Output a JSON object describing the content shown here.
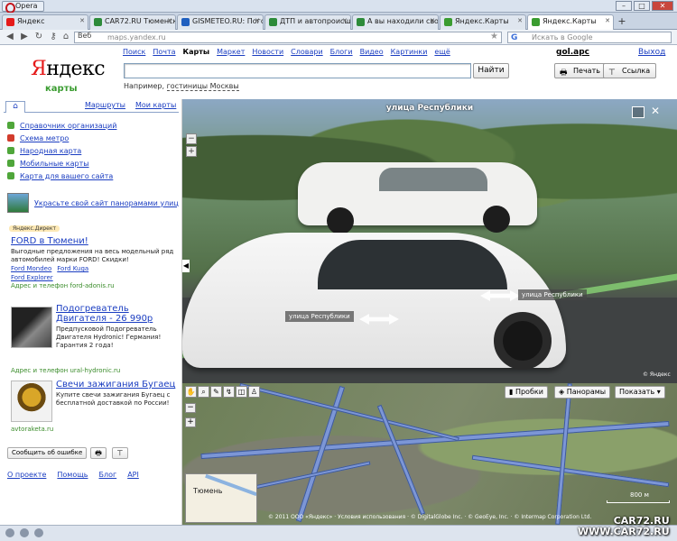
{
  "browser": {
    "app_button": "Opera",
    "tabs": [
      {
        "label": "Яндекс",
        "color": "#e51a1a"
      },
      {
        "label": "CAR72.RU Тюменски...",
        "color": "#2d8b3a"
      },
      {
        "label": "GISMETEO.RU: Погод...",
        "color": "#1f5fbf"
      },
      {
        "label": "ДТП и автопроисше...",
        "color": "#2d8b3a"
      },
      {
        "label": "А вы находили свой ...",
        "color": "#2d8b3a"
      },
      {
        "label": "Яндекс.Карты",
        "color": "#3a9c30"
      },
      {
        "label": "Яндекс.Карты",
        "color": "#3a9c30",
        "active": true
      }
    ],
    "web_label": "Веб",
    "url": "maps.yandex.ru",
    "search_placeholder": "Искать в Google"
  },
  "header": {
    "logo_first": "Я",
    "logo_rest": "ндекс",
    "logo_sub": "карты",
    "nav": [
      "Поиск",
      "Почта",
      "Карты",
      "Маркет",
      "Новости",
      "Словари",
      "Блоги",
      "Видео",
      "Картинки",
      "ещё"
    ],
    "current_nav": "Карты",
    "user": "gol.apc",
    "exit": "Выход",
    "find_button": "Найти",
    "example_prefix": "Например,",
    "example_link": "гостиницы Москвы",
    "print_button": "Печать",
    "link_button": "Ссылка"
  },
  "sidebar": {
    "tabs": [
      "Маршруты",
      "Мои карты"
    ],
    "links": [
      "Справочник организаций",
      "Схема метро",
      "Народная карта",
      "Мобильные карты",
      "Карта для вашего сайта"
    ],
    "pano_promo": "Украсьте свой сайт панорамами улиц",
    "direct_badge": "Яндекс.Директ",
    "ads": [
      {
        "title": "FORD в Тюмени!",
        "text": "Выгодные предложения на весь модельный ряд автомобилей марки FORD! Скидки!",
        "links": [
          "Ford Mondeo",
          "Ford Kuga",
          "Ford Explorer"
        ],
        "contact_label": "Адрес и телефон",
        "contact_site": "ford-adonis.ru"
      },
      {
        "title": "Подогреватель Двигателя - 26 990р",
        "text": "Предпусковой Подогреватель Двигателя Hydronic! Германия! Гарантия 2 года!",
        "contact_label": "Адрес и телефон",
        "contact_site": "ural-hydronic.ru"
      },
      {
        "title": "Свечи зажигания Бугаец",
        "text": "Купите свечи зажигания Бугаец с бесплатной доставкой по России!",
        "contact_site": "avtoraketa.ru"
      }
    ],
    "error_button": "Сообщить об ошибке",
    "footer": [
      "О проекте",
      "Помощь",
      "Блог",
      "API"
    ]
  },
  "panorama": {
    "title": "улица Республики",
    "label_right": "улица Республики",
    "label_left": "улица Республики",
    "copyright": "© Яндекс"
  },
  "map": {
    "btn_traffic": "Пробки",
    "btn_panoramas": "Панорамы",
    "btn_show": "Показать ▾",
    "minimap_city": "Тюмень",
    "scale": "800 м",
    "copyright": "© 2011 ООО «Яндекс» · Условия использования · © DigitalGlobe Inc. · © GeoEye, Inc. · © Intermap Corporation Ltd."
  },
  "watermark": {
    "line1": "CAR72.RU",
    "line2": "WWW.CAR72.RU"
  }
}
